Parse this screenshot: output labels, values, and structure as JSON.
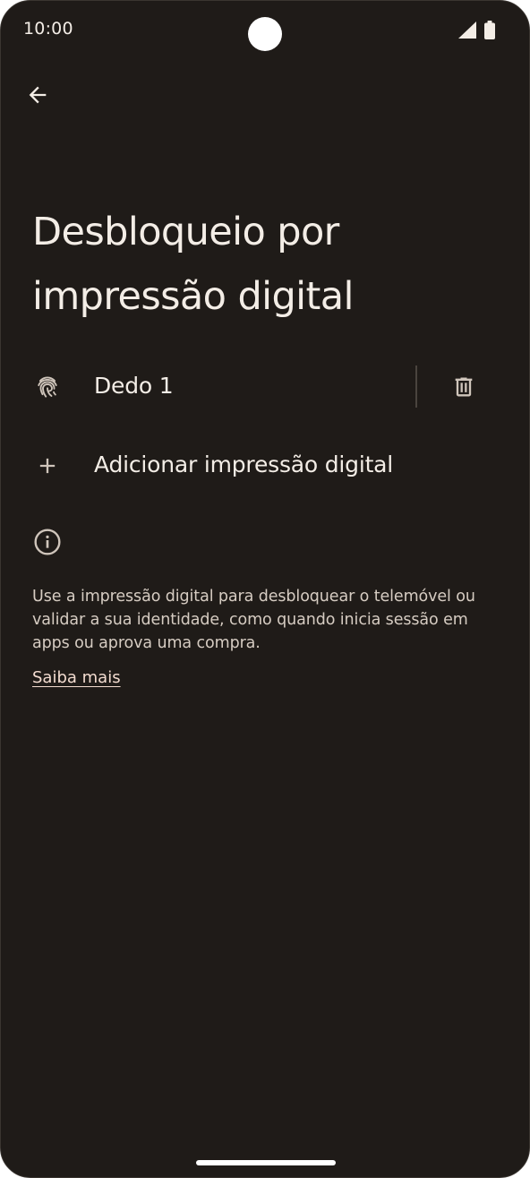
{
  "status_bar": {
    "time": "10:00"
  },
  "header": {
    "back_icon": "arrow-back-icon"
  },
  "page": {
    "title": "Desbloqueio por impressão digital"
  },
  "fingerprints": [
    {
      "label": "Dedo 1",
      "icon": "fingerprint-icon",
      "delete_icon": "trash-icon"
    }
  ],
  "add_fingerprint": {
    "label": "Adicionar impressão digital",
    "icon": "plus-icon"
  },
  "info": {
    "icon": "info-icon",
    "text": "Use a impressão digital para desbloquear o telemóvel ou validar a sua identidade, como quando inicia sessão em apps ou aprova uma compra.",
    "link_label": "Saiba mais"
  },
  "colors": {
    "background": "#1f1b18",
    "text_primary": "#f3ede6",
    "text_secondary": "#d6ccc2",
    "link": "#f3dcd0"
  }
}
